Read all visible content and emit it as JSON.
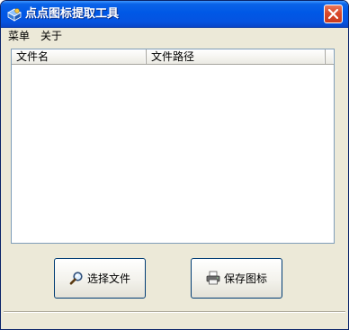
{
  "window": {
    "title": "点点图标提取工具",
    "icon": "app-icon",
    "close_icon": "close-icon"
  },
  "menu": {
    "items": [
      {
        "label": "菜单"
      },
      {
        "label": "关于"
      }
    ]
  },
  "file_list": {
    "columns": [
      {
        "label": "文件名"
      },
      {
        "label": "文件路径"
      },
      {
        "label": ""
      }
    ],
    "rows": []
  },
  "buttons": {
    "select_file": {
      "label": "选择文件",
      "icon": "magnifier-icon"
    },
    "save_icon": {
      "label": "保存图标",
      "icon": "printer-icon"
    }
  },
  "status": {
    "text": ""
  },
  "colors": {
    "titlebar": "#0058e6",
    "window_bg": "#ece9d8",
    "close_button": "#d9492b",
    "border": "#7f9db9"
  }
}
